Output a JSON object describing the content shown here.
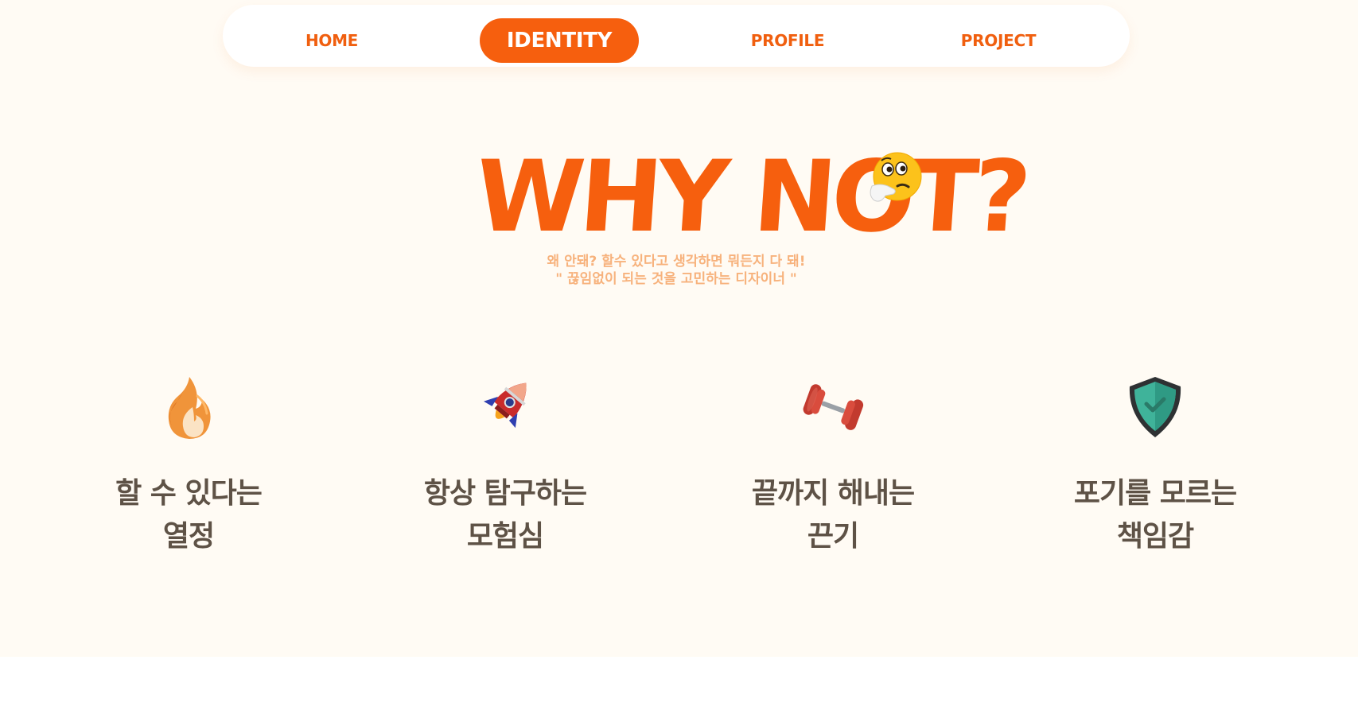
{
  "nav": {
    "items": [
      {
        "label": "HOME"
      },
      {
        "label": "IDENTITY",
        "active": true
      },
      {
        "label": "PROFILE"
      },
      {
        "label": "PROJECT"
      }
    ]
  },
  "hero": {
    "title": "WHY NOT?",
    "emoji": "thinking-face-icon",
    "subtitle_line1": "왜 안돼? 할수 있다고 생각하면 뭐든지 다 돼!",
    "subtitle_line2": "\" 끊임없이 되는 것을 고민하는 디자이너 \""
  },
  "values": [
    {
      "icon": "fire-icon",
      "line1": "할 수 있다는",
      "line2": "열정"
    },
    {
      "icon": "rocket-icon",
      "line1": "항상 탐구하는",
      "line2": "모험심"
    },
    {
      "icon": "dumbbell-icon",
      "line1": "끝까지 해내는",
      "line2": "끈기"
    },
    {
      "icon": "shield-check-icon",
      "line1": "포기를 모르는",
      "line2": "책임감"
    }
  ],
  "colors": {
    "accent": "#f65f0e",
    "background": "#fffbf4",
    "subtitle": "#f7b27c",
    "text": "#5e5246"
  }
}
